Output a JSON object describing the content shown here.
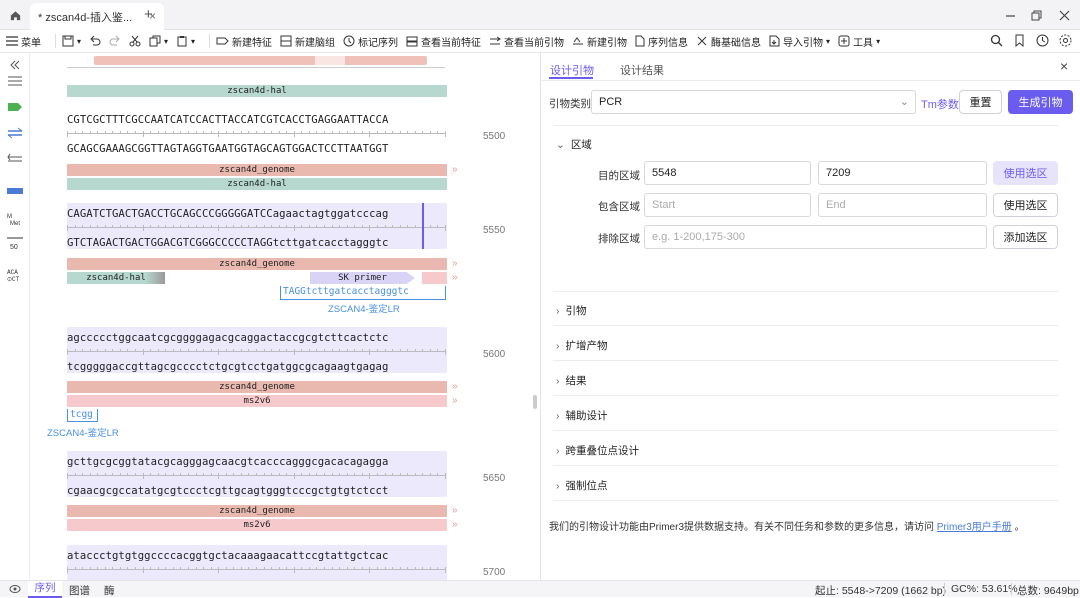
{
  "window": {
    "tab_title": "* zscan4d-插入鉴...",
    "tab_close": "×",
    "new_tab": "+"
  },
  "toolbar": {
    "menu": "菜单",
    "new_feature": "新建特征",
    "new_primer_set": "新建脑组",
    "mark_sequence": "标记序列",
    "view_current_feature": "查看当前特征",
    "view_current_primer": "查看当前引物",
    "new_primer": "新建引物",
    "sequence_info": "序列信息",
    "base_info": "酶基础信息",
    "import_primer": "导入引物",
    "tools": "工具"
  },
  "sequence": {
    "top_feature": "zscan4d-hal",
    "blocks": [
      {
        "top": "CGTCGCTTTCGCCAATCATCCACTTACCATCGTCACCTGAGGAATTACCA",
        "bottom": "GCAGCGAAAGCGGTTAGTAGGTGAATGGTAGCAGTGGACTCCTTAATGGT",
        "pos": "5500",
        "features": [
          "zscan4d_genome",
          "zscan4d-hal"
        ]
      },
      {
        "top": "CAGATCTGACTGACCTGCAGCCCGGGGGATCCagaactagtggatcccag",
        "bottom": "GTCTAGACTGACTGGACGTCGGGCCCCCTAGGtcttgatcacctagggtc",
        "pos": "5550",
        "features": [
          "zscan4d_genome",
          "zscan4d-hal",
          "SK primer"
        ],
        "primer_seq": "TAGGtcttgatcacctagggtc",
        "primer_name": "ZSCAN4-鉴定LR"
      },
      {
        "top": "agccccctggcaatcgcggggagacgcaggactaccgcgtcttcactctc",
        "bottom": "tcgggggaccgttagcgcccctctgcgtcctgatggcgcagaagtgagag",
        "pos": "5600",
        "features": [
          "zscan4d_genome",
          "ms2v6"
        ],
        "primer_seq": "tcgg",
        "primer_name": "ZSCAN4-鉴定LR"
      },
      {
        "top": "gcttgcgcggtatacgcagggagcaacgtcacccagggcgacacagagga",
        "bottom": "cgaacgcgccatatgcgtccctcgttgcagtgggtcccgctgtgtctcct",
        "pos": "5650",
        "features": [
          "zscan4d_genome",
          "ms2v6"
        ]
      },
      {
        "top": "ataccctgtgtggccccacggtgctacaaagaacattccgtattgctcac",
        "bottom": "",
        "pos": "5700",
        "features": []
      }
    ]
  },
  "primer_panel": {
    "tab_design": "设计引物",
    "tab_results": "设计结果",
    "primer_type_label": "引物类别",
    "primer_type_value": "PCR",
    "tm_params": "Tm参数",
    "reset": "重置",
    "generate": "生成引物",
    "region_section": "区域",
    "target_label": "目的区域",
    "target_start": "5548",
    "target_end": "7209",
    "use_selection": "使用选区",
    "include_label": "包含区域",
    "include_start_ph": "Start",
    "include_end_ph": "End",
    "exclude_label": "排除区域",
    "exclude_ph": "e.g. 1-200,175-300",
    "add_selection": "添加选区",
    "sections": [
      "引物",
      "扩增产物",
      "结果",
      "辅助设计",
      "跨重叠位点设计",
      "强制位点"
    ],
    "footer_text": "我们的引物设计功能由Primer3提供数据支持。有关不同任务和参数的更多信息，请访问",
    "footer_link": "Primer3用户手册",
    "footer_end": "。"
  },
  "status": {
    "tab_sequence": "序列",
    "tab_map": "图谱",
    "tab_enzyme": "酶",
    "range": "起止: 5548->7209 (1662 bp)",
    "gc": "GC%: 53.61%",
    "total": "总数: 9649bp"
  },
  "colors": {
    "accent": "#6b5cf0",
    "genome": "#e9b9b0",
    "hal": "#b6d8cf",
    "ms2": "#f6c9cd",
    "primer": "#4a90e2",
    "selection": "#ebe9fb"
  }
}
